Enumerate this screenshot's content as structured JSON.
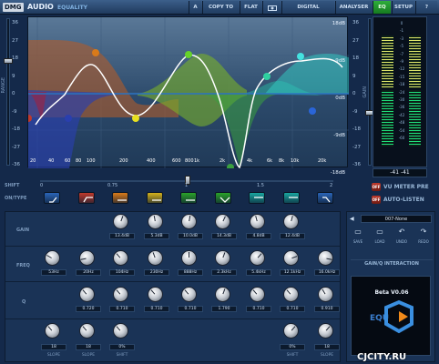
{
  "topbar": {
    "logo": "DMG",
    "brand": "AUDIO",
    "product": "EQUALITY",
    "home_icon": "A",
    "buttons": [
      "COPY TO",
      "FLAT",
      "DIGITAL",
      "ANALYSER",
      "EQ",
      "SETUP"
    ],
    "camera_icon": "camera-icon",
    "active": "EQ",
    "active_color": "#2fae3a"
  },
  "graph": {
    "left_scale": [
      "36",
      "27",
      "18",
      "9",
      "0",
      "-9",
      "-18",
      "-27",
      "-36"
    ],
    "left_label": "RANGE",
    "right_db": [
      "18dB",
      "9dB",
      "0dB",
      "-9dB",
      "-18dB"
    ],
    "right_scale": [
      "36",
      "27",
      "18",
      "9",
      "0",
      "-9",
      "-18",
      "-27",
      "-36"
    ],
    "right_label": "GAIN",
    "x_ticks": [
      "20",
      "40",
      "60",
      "80",
      "100",
      "200",
      "400",
      "600",
      "800",
      "1k",
      "2k",
      "4k",
      "6k",
      "8k",
      "10k",
      "20k"
    ]
  },
  "meters": {
    "readout": "-41 -41",
    "scale": [
      "0",
      "-1",
      "-3",
      "-5",
      "-7",
      "-9",
      "-12",
      "-15",
      "-18",
      "-24",
      "-30",
      "-36",
      "-42",
      "-48",
      "-54",
      "-60"
    ]
  },
  "options": {
    "vu": "VU METER PRE",
    "auto": "AUTO-LISTEN",
    "off": "OFF"
  },
  "shift": {
    "label": "SHIFT",
    "ticks": [
      "0",
      "0.75",
      "1",
      "1.5",
      "2"
    ]
  },
  "ontype": {
    "label": "ON/TYPE",
    "colors": [
      "#2a65b8",
      "#c0392b",
      "#d97a1a",
      "#d6b21c",
      "#2aa22a",
      "#2aa22a",
      "#19a6a0",
      "#19a6a0",
      "#2a65b8"
    ]
  },
  "gain": {
    "label": "GAIN",
    "values": [
      "13.4dB",
      "5.3dB",
      "10.0dB",
      "14.3dB",
      "4.8dB",
      "12.4dB"
    ]
  },
  "freq": {
    "label": "FREQ",
    "values": [
      "53Hz",
      "20Hz",
      "104Hz",
      "230Hz",
      "888Hz",
      "2.3kHz",
      "5.4kHz",
      "12.1kHz",
      "16.0kHz"
    ]
  },
  "q": {
    "label": "Q",
    "values": [
      "0.720",
      "0.710",
      "0.710",
      "0.710",
      "1.790",
      "0.710",
      "0.710",
      "0.910"
    ]
  },
  "slopes": {
    "left": [
      {
        "value": "18",
        "label": "SLOPE"
      },
      {
        "value": "18",
        "label": "SLOPE"
      },
      {
        "value": "0%",
        "label": "SHIFT"
      }
    ],
    "right": [
      {
        "value": "0%",
        "label": "SHIFT"
      },
      {
        "value": "18",
        "label": "SLOPE"
      }
    ]
  },
  "preset": {
    "name": "007-None",
    "actions": [
      "SAVE",
      "LOAD",
      "UNDO",
      "REDO"
    ],
    "gain_q": "GAIN/Q INTERACTION",
    "version": "Beta V0.06"
  },
  "watermark": "CJCITY.RU"
}
